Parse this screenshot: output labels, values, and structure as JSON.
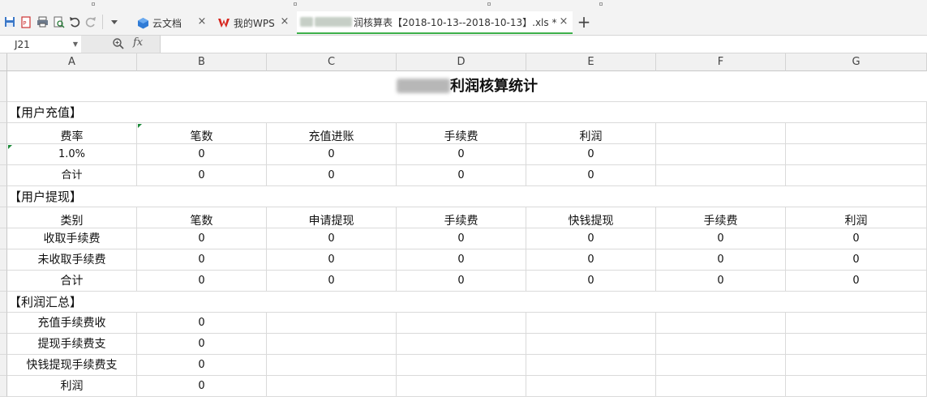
{
  "tabs": [
    {
      "label": "云文档",
      "icon": "cloud-docs-icon"
    },
    {
      "label": "我的WPS",
      "icon": "wps-logo-icon"
    },
    {
      "label": "润核算表【2018-10-13--2018-10-13】.xls *",
      "icon": "spreadsheet-icon"
    }
  ],
  "formula_bar": {
    "cell_ref": "J21",
    "formula": "fx",
    "value": ""
  },
  "columns": [
    "A",
    "B",
    "C",
    "D",
    "E",
    "F",
    "G"
  ],
  "sheet": {
    "title_visible": "利润核算统计",
    "section1": {
      "heading": "【用户充值】",
      "headers": [
        "费率",
        "笔数",
        "充值进账",
        "手续费",
        "利润"
      ],
      "rows": [
        [
          "1.0%",
          "0",
          "0",
          "0",
          "0"
        ],
        [
          "合计",
          "0",
          "0",
          "0",
          "0"
        ]
      ]
    },
    "section2": {
      "heading": "【用户提现】",
      "headers": [
        "类别",
        "笔数",
        "申请提现",
        "手续费",
        "快钱提现",
        "手续费",
        "利润"
      ],
      "rows": [
        [
          "收取手续费",
          "0",
          "0",
          "0",
          "0",
          "0",
          "0"
        ],
        [
          "未收取手续费",
          "0",
          "0",
          "0",
          "0",
          "0",
          "0"
        ],
        [
          "合计",
          "0",
          "0",
          "0",
          "0",
          "0",
          "0"
        ]
      ]
    },
    "section3": {
      "heading": "【利润汇总】",
      "rows": [
        [
          "充值手续费收",
          "0"
        ],
        [
          "提现手续费支",
          "0"
        ],
        [
          "快钱提现手续费支",
          "0"
        ],
        [
          "利润",
          "0"
        ]
      ]
    }
  },
  "colors": {
    "active_tab_underline": "#3db04a",
    "grid_line": "#dadada",
    "header_bg": "#f1f1f1"
  }
}
